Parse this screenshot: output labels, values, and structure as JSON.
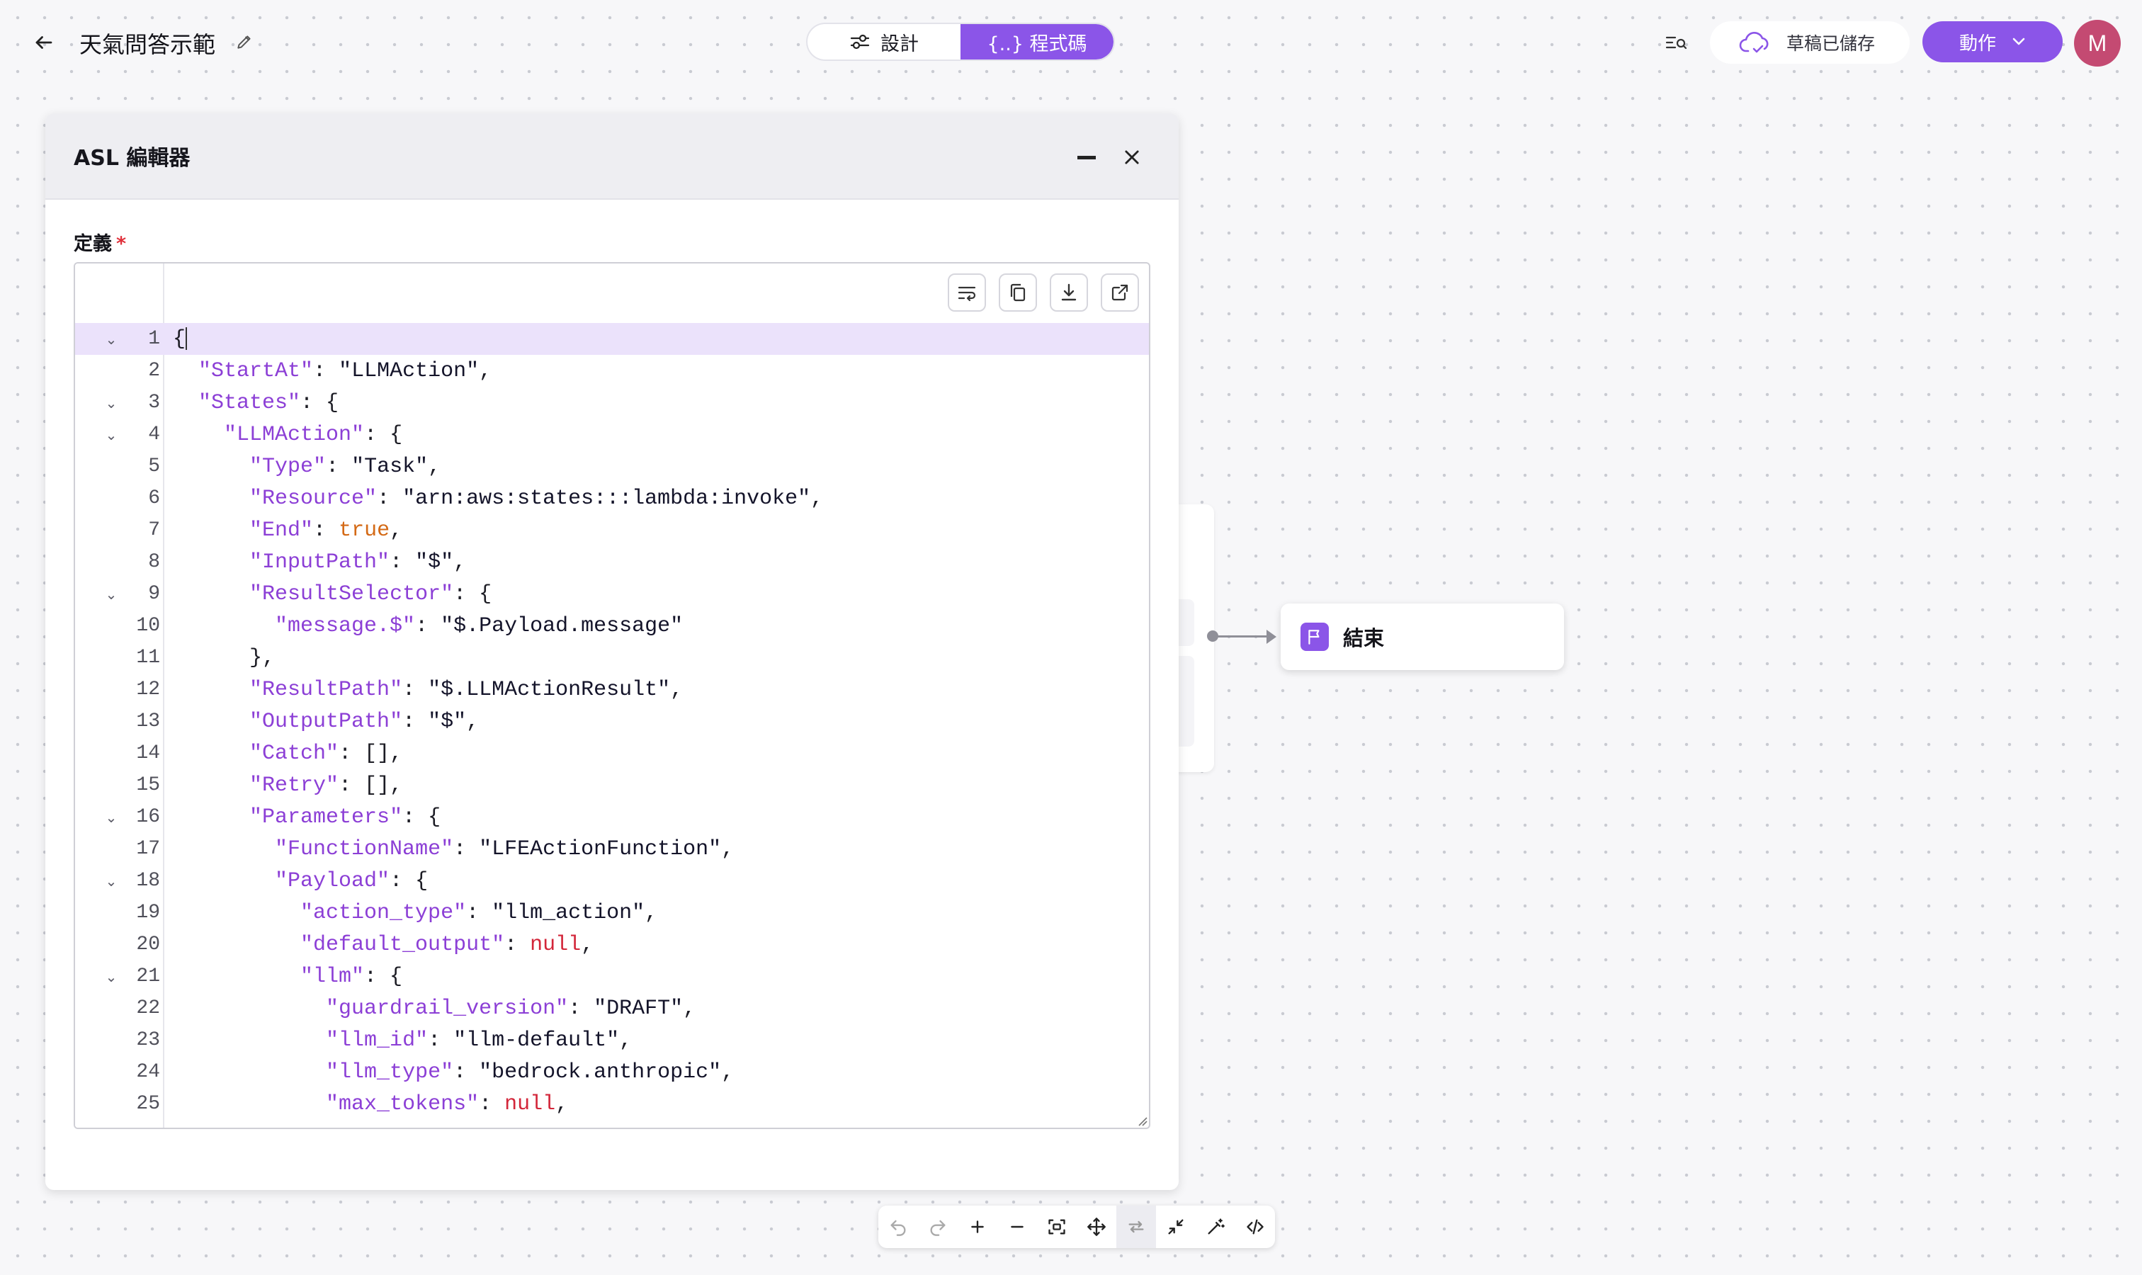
{
  "header": {
    "title": "天氣問答示範",
    "tabs": [
      {
        "label": "設計",
        "icon": "sliders-icon",
        "active": false
      },
      {
        "label": "{..} 程式碼",
        "icon": "braces-icon",
        "active": true
      }
    ],
    "draft_status": "草稿已儲存",
    "action_label": "動作",
    "avatar_initial": "M"
  },
  "panel": {
    "title": "ASL 編輯器",
    "field_label": "定義",
    "required_mark": "*"
  },
  "editor": {
    "active_line": 1,
    "lines": [
      {
        "n": "1",
        "fold": true,
        "text": "{"
      },
      {
        "n": "2",
        "fold": false,
        "text": "  \"StartAt\": \"LLMAction\","
      },
      {
        "n": "3",
        "fold": true,
        "text": "  \"States\": {"
      },
      {
        "n": "4",
        "fold": true,
        "text": "    \"LLMAction\": {"
      },
      {
        "n": "5",
        "fold": false,
        "text": "      \"Type\": \"Task\","
      },
      {
        "n": "6",
        "fold": false,
        "text": "      \"Resource\": \"arn:aws:states:::lambda:invoke\","
      },
      {
        "n": "7",
        "fold": false,
        "text": "      \"End\": true,"
      },
      {
        "n": "8",
        "fold": false,
        "text": "      \"InputPath\": \"$\","
      },
      {
        "n": "9",
        "fold": true,
        "text": "      \"ResultSelector\": {"
      },
      {
        "n": "10",
        "fold": false,
        "text": "        \"message.$\": \"$.Payload.message\""
      },
      {
        "n": "11",
        "fold": false,
        "text": "      },"
      },
      {
        "n": "12",
        "fold": false,
        "text": "      \"ResultPath\": \"$.LLMActionResult\","
      },
      {
        "n": "13",
        "fold": false,
        "text": "      \"OutputPath\": \"$\","
      },
      {
        "n": "14",
        "fold": false,
        "text": "      \"Catch\": [],"
      },
      {
        "n": "15",
        "fold": false,
        "text": "      \"Retry\": [],"
      },
      {
        "n": "16",
        "fold": true,
        "text": "      \"Parameters\": {"
      },
      {
        "n": "17",
        "fold": false,
        "text": "        \"FunctionName\": \"LFEActionFunction\","
      },
      {
        "n": "18",
        "fold": true,
        "text": "        \"Payload\": {"
      },
      {
        "n": "19",
        "fold": false,
        "text": "          \"action_type\": \"llm_action\","
      },
      {
        "n": "20",
        "fold": false,
        "text": "          \"default_output\": null,"
      },
      {
        "n": "21",
        "fold": true,
        "text": "          \"llm\": {"
      },
      {
        "n": "22",
        "fold": false,
        "text": "            \"guardrail_version\": \"DRAFT\","
      },
      {
        "n": "23",
        "fold": false,
        "text": "            \"llm_id\": \"llm-default\","
      },
      {
        "n": "24",
        "fold": false,
        "text": "            \"llm_type\": \"bedrock.anthropic\","
      },
      {
        "n": "25",
        "fold": false,
        "text": "            \"max_tokens\": null,"
      }
    ]
  },
  "flow": {
    "end_node_label": "結束"
  },
  "icons": {
    "back": "arrow-left-icon",
    "edit": "pencil-icon",
    "search": "search-list-icon",
    "cloud": "cloud-check-icon",
    "chevron": "chevron-down-icon"
  },
  "colors": {
    "accent": "#8b55e8",
    "avatar": "#c44a72",
    "key": "#8c3fd6",
    "true_literal": "#d46a16",
    "null_literal": "#d3263a",
    "active_line": "#ebe2fb"
  }
}
